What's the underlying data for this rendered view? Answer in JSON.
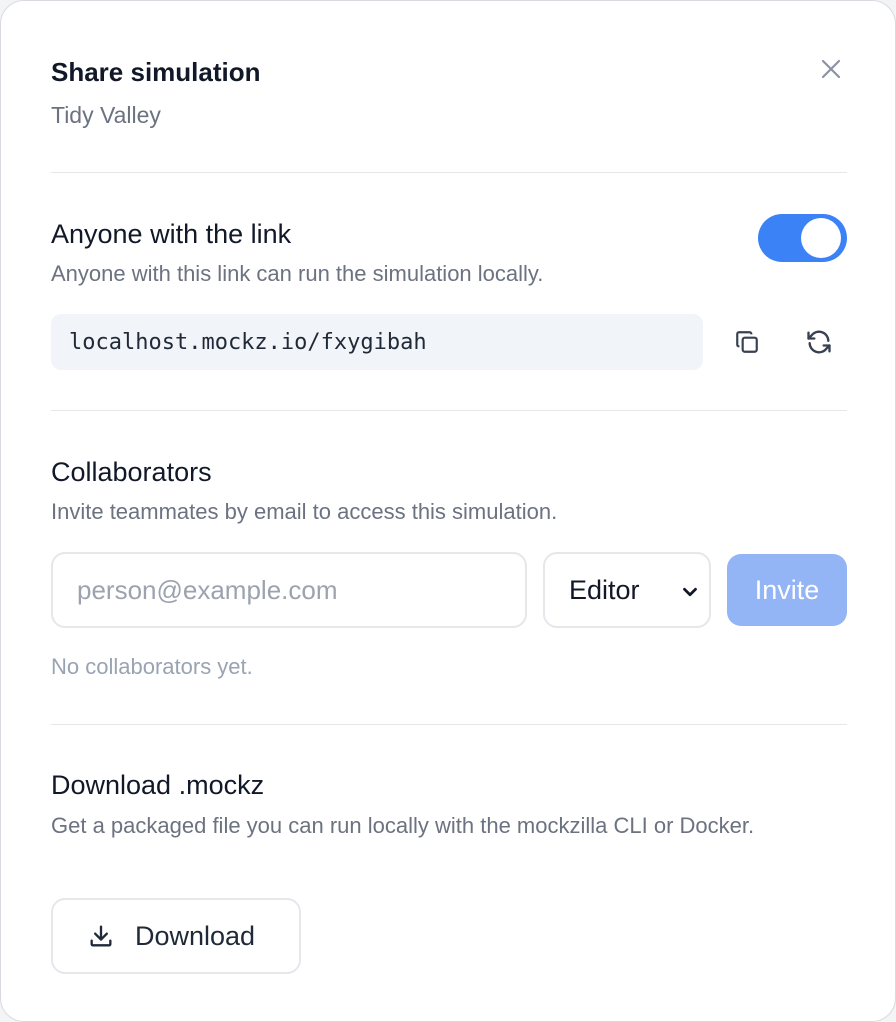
{
  "dialog": {
    "title": "Share simulation",
    "subtitle": "Tidy Valley",
    "close_icon": "close-icon"
  },
  "link_sharing": {
    "title": "Anyone with the link",
    "description": "Anyone with this link can run the simulation locally.",
    "enabled": true,
    "url": "localhost.mockz.io/fxygibah",
    "copy_icon": "copy-icon",
    "regenerate_icon": "refresh-icon"
  },
  "collaborators": {
    "title": "Collaborators",
    "description": "Invite teammates by email to access this simulation.",
    "email_placeholder": "person@example.com",
    "email_value": "",
    "role_selected": "Editor",
    "invite_label": "Invite",
    "empty_text": "No collaborators yet."
  },
  "download": {
    "title": "Download .mockz",
    "description": "Get a packaged file you can run locally with the mockzilla CLI or Docker.",
    "button_label": "Download",
    "button_icon": "download-icon"
  },
  "colors": {
    "accent": "#3b82f6",
    "invite_disabled": "#93b4f5",
    "text_primary": "#111827",
    "text_secondary": "#6b7280"
  }
}
